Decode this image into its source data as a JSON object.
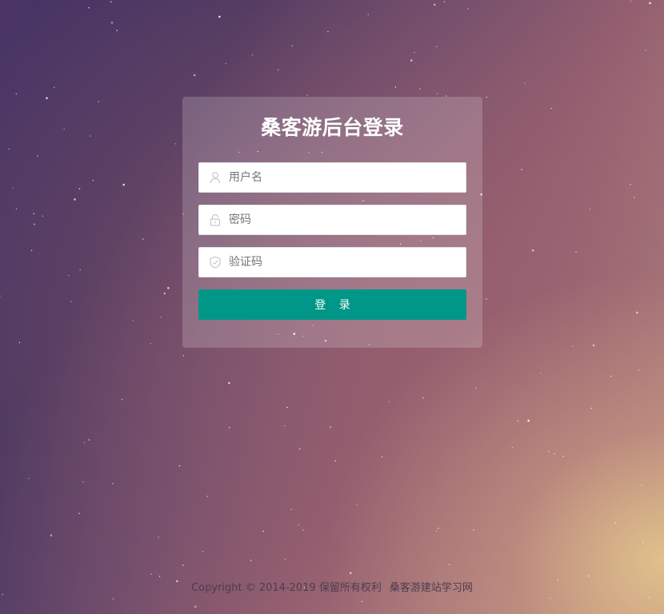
{
  "login": {
    "title": "桑客游后台登录",
    "username_placeholder": "用户名",
    "password_placeholder": "密码",
    "captcha_placeholder": "验证码",
    "submit_label": "登 录"
  },
  "icons": {
    "username": "user-icon",
    "password": "lock-icon",
    "captcha": "shield-check-icon"
  },
  "footer": {
    "copyright": "Copyright © 2014-2019 保留所有权利",
    "site_link": "桑客游建站学习网"
  },
  "colors": {
    "button": "#009688",
    "title": "#ffffff"
  }
}
